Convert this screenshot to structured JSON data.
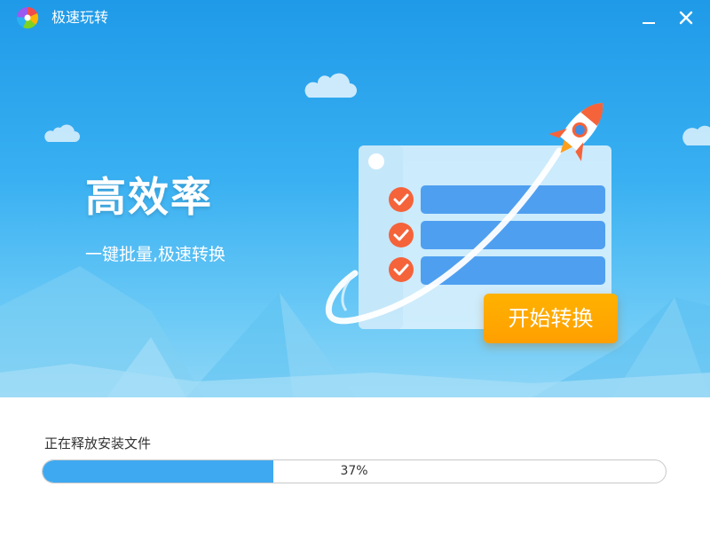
{
  "window": {
    "title": "极速玩转",
    "icons": {
      "logo": "colorful-wheel-logo",
      "minimize": "minimize-icon",
      "close": "close-icon"
    }
  },
  "hero": {
    "headline": "高效率",
    "tagline": "一键批量,极速转换",
    "start_button_label": "开始转换",
    "icons": [
      "rocket-icon",
      "check-circle-icon"
    ]
  },
  "install": {
    "status_text": "正在释放安装文件",
    "progress_percent": 37,
    "progress_label": "37%"
  },
  "colors": {
    "accent_blue": "#3ea9f1",
    "button_orange": "#ffa800",
    "check_orange": "#f5633a",
    "hero_top": "#1f9ae8",
    "hero_bottom": "#8ed6f7"
  }
}
